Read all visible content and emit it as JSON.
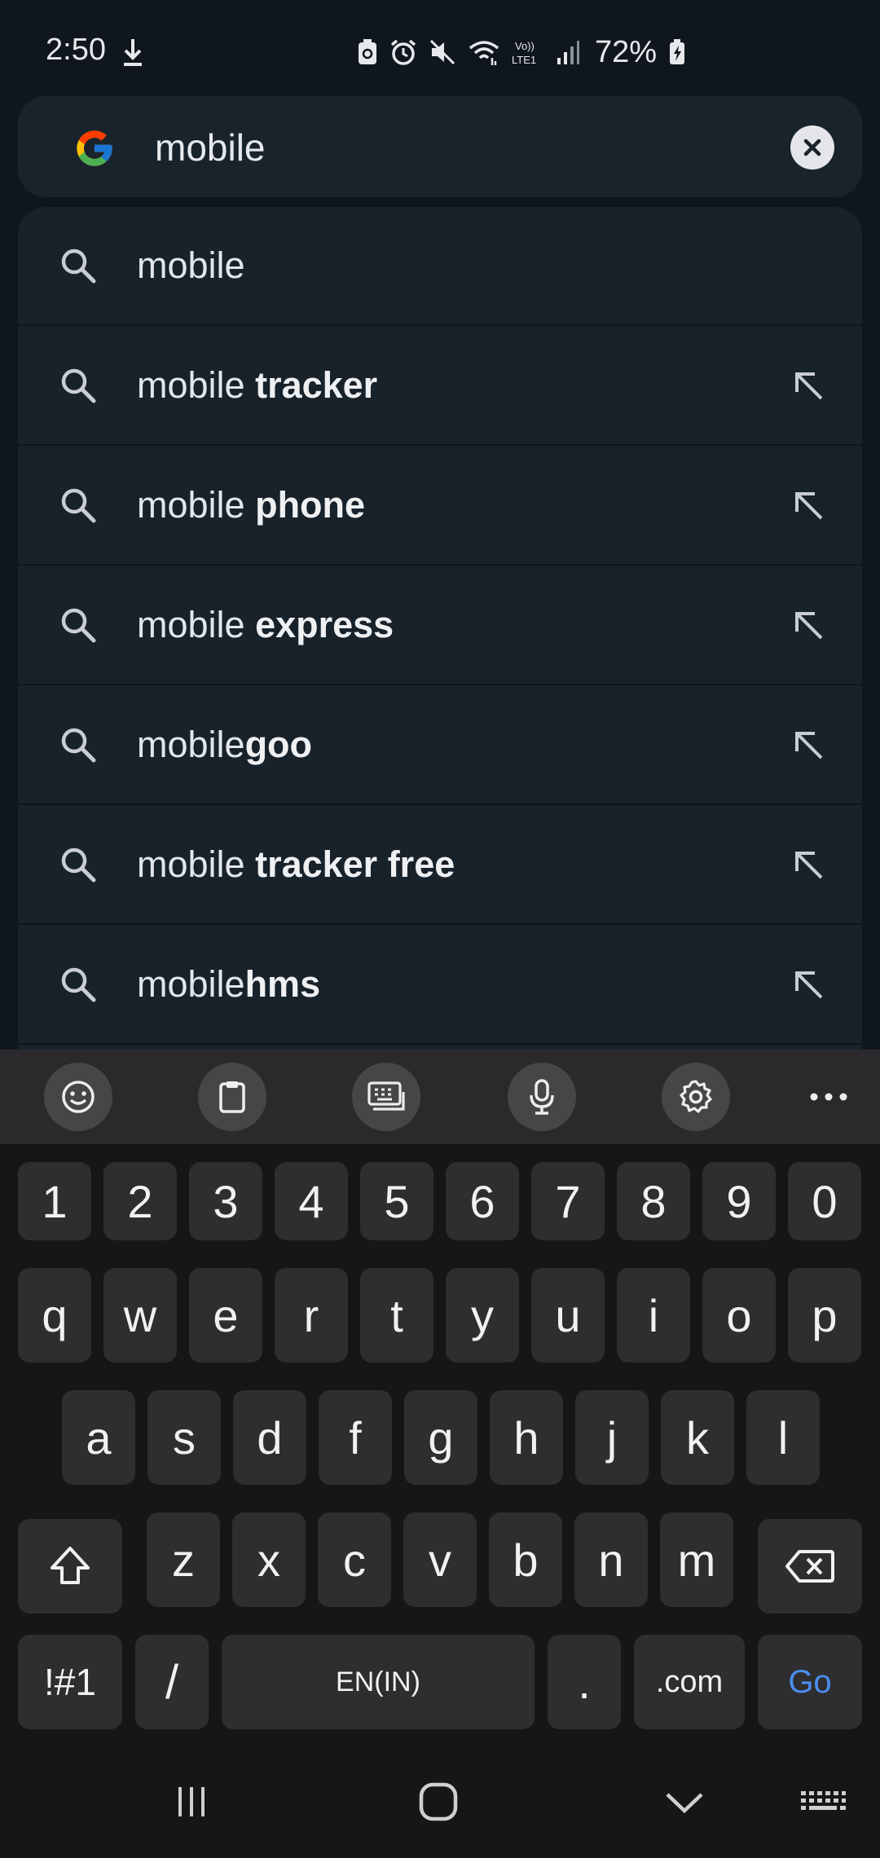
{
  "status": {
    "time": "2:50",
    "battery": "72%",
    "icons": [
      "download-icon",
      "battery-saver-icon",
      "alarm-icon",
      "mute-icon",
      "wifi-icon",
      "volte-icon",
      "signal-icon",
      "battery-charging-icon"
    ]
  },
  "search": {
    "query": "mobile",
    "logo": "google-logo",
    "clear_icon": "close-icon"
  },
  "suggestions": [
    {
      "prefix": "mobile",
      "bold": "",
      "fill": false
    },
    {
      "prefix": "mobile ",
      "bold": "tracker",
      "fill": true
    },
    {
      "prefix": "mobile ",
      "bold": "phone",
      "fill": true
    },
    {
      "prefix": "mobile ",
      "bold": "express",
      "fill": true
    },
    {
      "prefix": "mobile",
      "bold": "goo",
      "fill": true
    },
    {
      "prefix": "mobile ",
      "bold": "tracker free",
      "fill": true
    },
    {
      "prefix": "mobile",
      "bold": "hms",
      "fill": true
    }
  ],
  "toolbar": {
    "items": [
      "emoji-icon",
      "clipboard-icon",
      "keyboard-mode-icon",
      "microphone-icon",
      "settings-icon",
      "more-icon"
    ]
  },
  "keyboard": {
    "row_numbers": [
      "1",
      "2",
      "3",
      "4",
      "5",
      "6",
      "7",
      "8",
      "9",
      "0"
    ],
    "row_q": [
      "q",
      "w",
      "e",
      "r",
      "t",
      "y",
      "u",
      "i",
      "o",
      "p"
    ],
    "row_a": [
      "a",
      "s",
      "d",
      "f",
      "g",
      "h",
      "j",
      "k",
      "l"
    ],
    "row_z": [
      "z",
      "x",
      "c",
      "v",
      "b",
      "n",
      "m"
    ],
    "symbols": "!#1",
    "slash": "/",
    "space": "EN(IN)",
    "period": ".",
    "dotcom": ".com",
    "go": "Go"
  },
  "nav": {
    "items": [
      "recent-apps-icon",
      "home-icon",
      "back-icon",
      "keyboard-hide-icon"
    ]
  }
}
